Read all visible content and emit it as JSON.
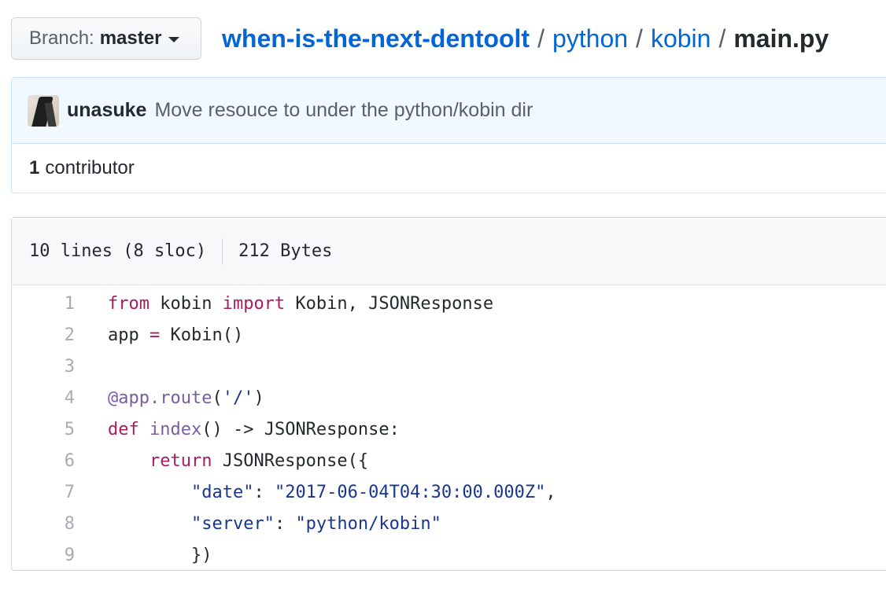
{
  "branch": {
    "label": "Branch:",
    "value": "master"
  },
  "breadcrumb": {
    "repo": "when-is-the-next-dentoolt",
    "sep": "/",
    "dir1": "python",
    "dir2": "kobin",
    "file": "main.py"
  },
  "commit": {
    "author": "unasuke",
    "message": "Move resouce to under the python/kobin dir"
  },
  "contributors": {
    "count": "1",
    "label": "contributor"
  },
  "file_info": {
    "lines": "10 lines (8 sloc)",
    "size": "212 Bytes"
  },
  "code_lines": [
    {
      "num": "1",
      "tokens": [
        {
          "t": "from",
          "c": "kw"
        },
        {
          "t": " kobin ",
          "c": ""
        },
        {
          "t": "import",
          "c": "kw"
        },
        {
          "t": " Kobin, JSONResponse",
          "c": ""
        }
      ]
    },
    {
      "num": "2",
      "tokens": [
        {
          "t": "app ",
          "c": ""
        },
        {
          "t": "=",
          "c": "kw"
        },
        {
          "t": " Kobin()",
          "c": ""
        }
      ]
    },
    {
      "num": "3",
      "tokens": []
    },
    {
      "num": "4",
      "tokens": [
        {
          "t": "@app.route",
          "c": "fn"
        },
        {
          "t": "(",
          "c": ""
        },
        {
          "t": "'/'",
          "c": "st"
        },
        {
          "t": ")",
          "c": ""
        }
      ]
    },
    {
      "num": "5",
      "tokens": [
        {
          "t": "def",
          "c": "kw"
        },
        {
          "t": " ",
          "c": ""
        },
        {
          "t": "index",
          "c": "fn"
        },
        {
          "t": "() -> JSONResponse:",
          "c": ""
        }
      ]
    },
    {
      "num": "6",
      "tokens": [
        {
          "t": "    ",
          "c": ""
        },
        {
          "t": "return",
          "c": "kw"
        },
        {
          "t": " JSONResponse({",
          "c": ""
        }
      ]
    },
    {
      "num": "7",
      "tokens": [
        {
          "t": "        ",
          "c": ""
        },
        {
          "t": "\"date\"",
          "c": "st"
        },
        {
          "t": ": ",
          "c": ""
        },
        {
          "t": "\"2017-06-04T04:30:00.000Z\"",
          "c": "st"
        },
        {
          "t": ",",
          "c": ""
        }
      ]
    },
    {
      "num": "8",
      "tokens": [
        {
          "t": "        ",
          "c": ""
        },
        {
          "t": "\"server\"",
          "c": "st"
        },
        {
          "t": ": ",
          "c": ""
        },
        {
          "t": "\"python/kobin\"",
          "c": "st"
        }
      ]
    },
    {
      "num": "9",
      "tokens": [
        {
          "t": "        })",
          "c": ""
        }
      ]
    }
  ],
  "colors": {
    "link": "#0366d6",
    "keyword": "#a71d5d",
    "function": "#795da3",
    "string": "#183691"
  }
}
